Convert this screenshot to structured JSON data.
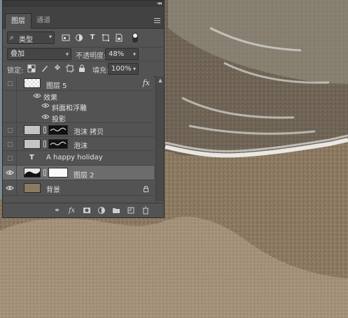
{
  "panel": {
    "tabs": [
      {
        "label": "图层",
        "active": true
      },
      {
        "label": "通道",
        "active": false
      }
    ],
    "collapse_glyph": "◂◂",
    "close_glyph": "×"
  },
  "filter": {
    "search_icon": "search-icon",
    "kind_label": "类型",
    "icons": [
      "pixel-filter-icon",
      "adjustment-filter-icon",
      "type-filter-icon",
      "shape-filter-icon",
      "smart-object-filter-icon",
      "filter-toggle-icon"
    ]
  },
  "blend": {
    "mode": "叠加",
    "opacity_label": "不透明度:",
    "opacity_value": "48%"
  },
  "lock": {
    "label": "锁定:",
    "icons": [
      "lock-transparent-icon",
      "lock-brush-icon",
      "lock-move-icon",
      "lock-artboard-icon",
      "lock-all-icon"
    ],
    "fill_label": "填充:",
    "fill_value": "100%"
  },
  "layers": [
    {
      "name": "图层 5",
      "visible": false,
      "has_fx": true,
      "fx_label": "fx"
    },
    {
      "name": "效果",
      "kind": "effects-header"
    },
    {
      "name": "斜面和浮雕",
      "kind": "effect"
    },
    {
      "name": "投影",
      "kind": "effect"
    },
    {
      "name": "泡沫 拷贝",
      "visible": false,
      "has_mask": true
    },
    {
      "name": "泡沫",
      "visible": false,
      "has_mask": true
    },
    {
      "name": "A happy holiday",
      "visible": false,
      "kind": "text",
      "type_glyph": "T"
    },
    {
      "name": "图层 2",
      "visible": true,
      "has_mask": true,
      "selected": true
    },
    {
      "name": "背景",
      "visible": true,
      "locked": true
    }
  ],
  "footer": {
    "icons": [
      "link-layers-icon",
      "fx-icon",
      "add-mask-icon",
      "adjustment-layer-icon",
      "group-folder-icon",
      "new-layer-icon",
      "trash-icon"
    ],
    "fx_label": "fx"
  }
}
